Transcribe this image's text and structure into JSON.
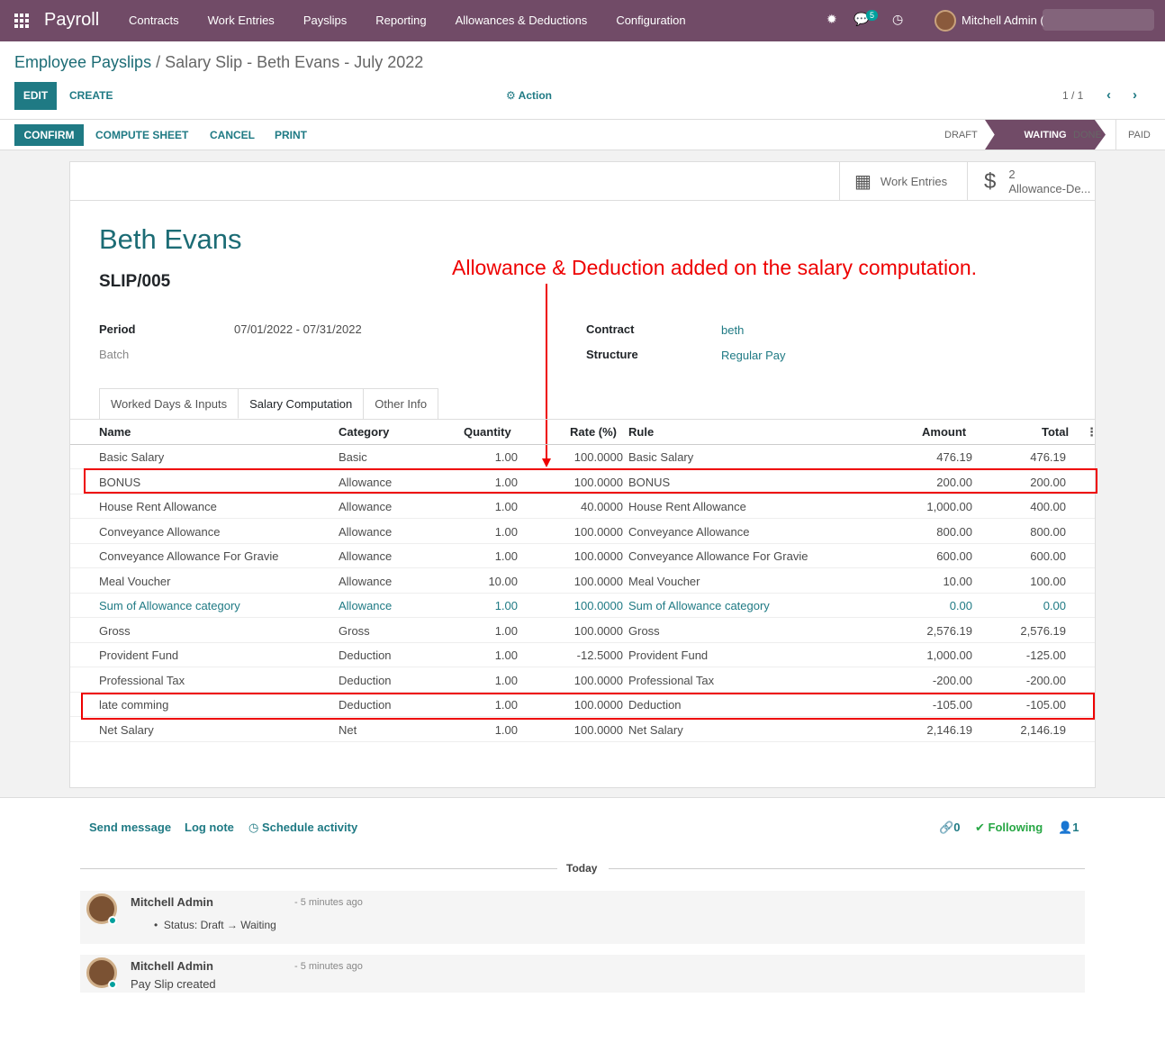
{
  "topbar": {
    "brand": "Payroll",
    "menu": [
      "Contracts",
      "Work Entries",
      "Payslips",
      "Reporting",
      "Allowances & Deductions",
      "Configuration"
    ],
    "messages_count": "5",
    "user": "Mitchell Admin ("
  },
  "breadcrumb": {
    "parent": "Employee Payslips",
    "separator": "/",
    "current": "Salary Slip - Beth Evans - July 2022"
  },
  "toolbar": {
    "edit": "EDIT",
    "create": "CREATE",
    "action": "Action",
    "pager": "1 / 1"
  },
  "statusbar": {
    "buttons": [
      "CONFIRM",
      "COMPUTE SHEET",
      "CANCEL",
      "PRINT"
    ],
    "stages": [
      "DRAFT",
      "WAITING",
      "DONE",
      "PAID"
    ]
  },
  "smart_buttons": {
    "work_entries": "Work Entries",
    "alloc_count": "2",
    "alloc_label": "Allowance-De..."
  },
  "employee": "Beth Evans",
  "slip_number": "SLIP/005",
  "annotation": "Allowance & Deduction added on the salary computation.",
  "fields": {
    "period_label": "Period",
    "period": "07/01/2022 - 07/31/2022",
    "batch_label": "Batch",
    "contract_label": "Contract",
    "contract": "beth",
    "structure_label": "Structure",
    "structure": "Regular Pay"
  },
  "tabs": [
    "Worked Days & Inputs",
    "Salary Computation",
    "Other Info"
  ],
  "table": {
    "headers": [
      "Name",
      "Category",
      "Quantity",
      "Rate (%)",
      "Rule",
      "Amount",
      "Total"
    ],
    "rows": [
      [
        "Basic Salary",
        "Basic",
        "1.00",
        "100.0000",
        "Basic Salary",
        "476.19",
        "476.19"
      ],
      [
        "BONUS",
        "Allowance",
        "1.00",
        "100.0000",
        "BONUS",
        "200.00",
        "200.00"
      ],
      [
        "House Rent Allowance",
        "Allowance",
        "1.00",
        "40.0000",
        "House Rent Allowance",
        "1,000.00",
        "400.00"
      ],
      [
        "Conveyance Allowance",
        "Allowance",
        "1.00",
        "100.0000",
        "Conveyance Allowance",
        "800.00",
        "800.00"
      ],
      [
        "Conveyance Allowance For Gravie",
        "Allowance",
        "1.00",
        "100.0000",
        "Conveyance Allowance For Gravie",
        "600.00",
        "600.00"
      ],
      [
        "Meal Voucher",
        "Allowance",
        "10.00",
        "100.0000",
        "Meal Voucher",
        "10.00",
        "100.00"
      ],
      [
        "Sum of Allowance category",
        "Allowance",
        "1.00",
        "100.0000",
        "Sum of Allowance category",
        "0.00",
        "0.00"
      ],
      [
        "Gross",
        "Gross",
        "1.00",
        "100.0000",
        "Gross",
        "2,576.19",
        "2,576.19"
      ],
      [
        "Provident Fund",
        "Deduction",
        "1.00",
        "-12.5000",
        "Provident Fund",
        "1,000.00",
        "-125.00"
      ],
      [
        "Professional Tax",
        "Deduction",
        "1.00",
        "100.0000",
        "Professional Tax",
        "-200.00",
        "-200.00"
      ],
      [
        "late comming",
        "Deduction",
        "1.00",
        "100.0000",
        "Deduction",
        "-105.00",
        "-105.00"
      ],
      [
        "Net Salary",
        "Net",
        "1.00",
        "100.0000",
        "Net Salary",
        "2,146.19",
        "2,146.19"
      ]
    ]
  },
  "chatter": {
    "send_message": "Send message",
    "log_note": "Log note",
    "schedule": "Schedule activity",
    "attachments": "0",
    "following": "Following",
    "followers": "1",
    "today": "Today",
    "messages": [
      {
        "author": "Mitchell Admin",
        "ago": "- 5 minutes ago",
        "body": "Status: Draft → Waiting"
      },
      {
        "author": "Mitchell Admin",
        "ago": "- 5 minutes ago",
        "body": "Pay Slip created"
      }
    ]
  },
  "colors": {
    "brand": "#714b67",
    "primary": "#1f7a84",
    "annotation": "#e00000"
  }
}
